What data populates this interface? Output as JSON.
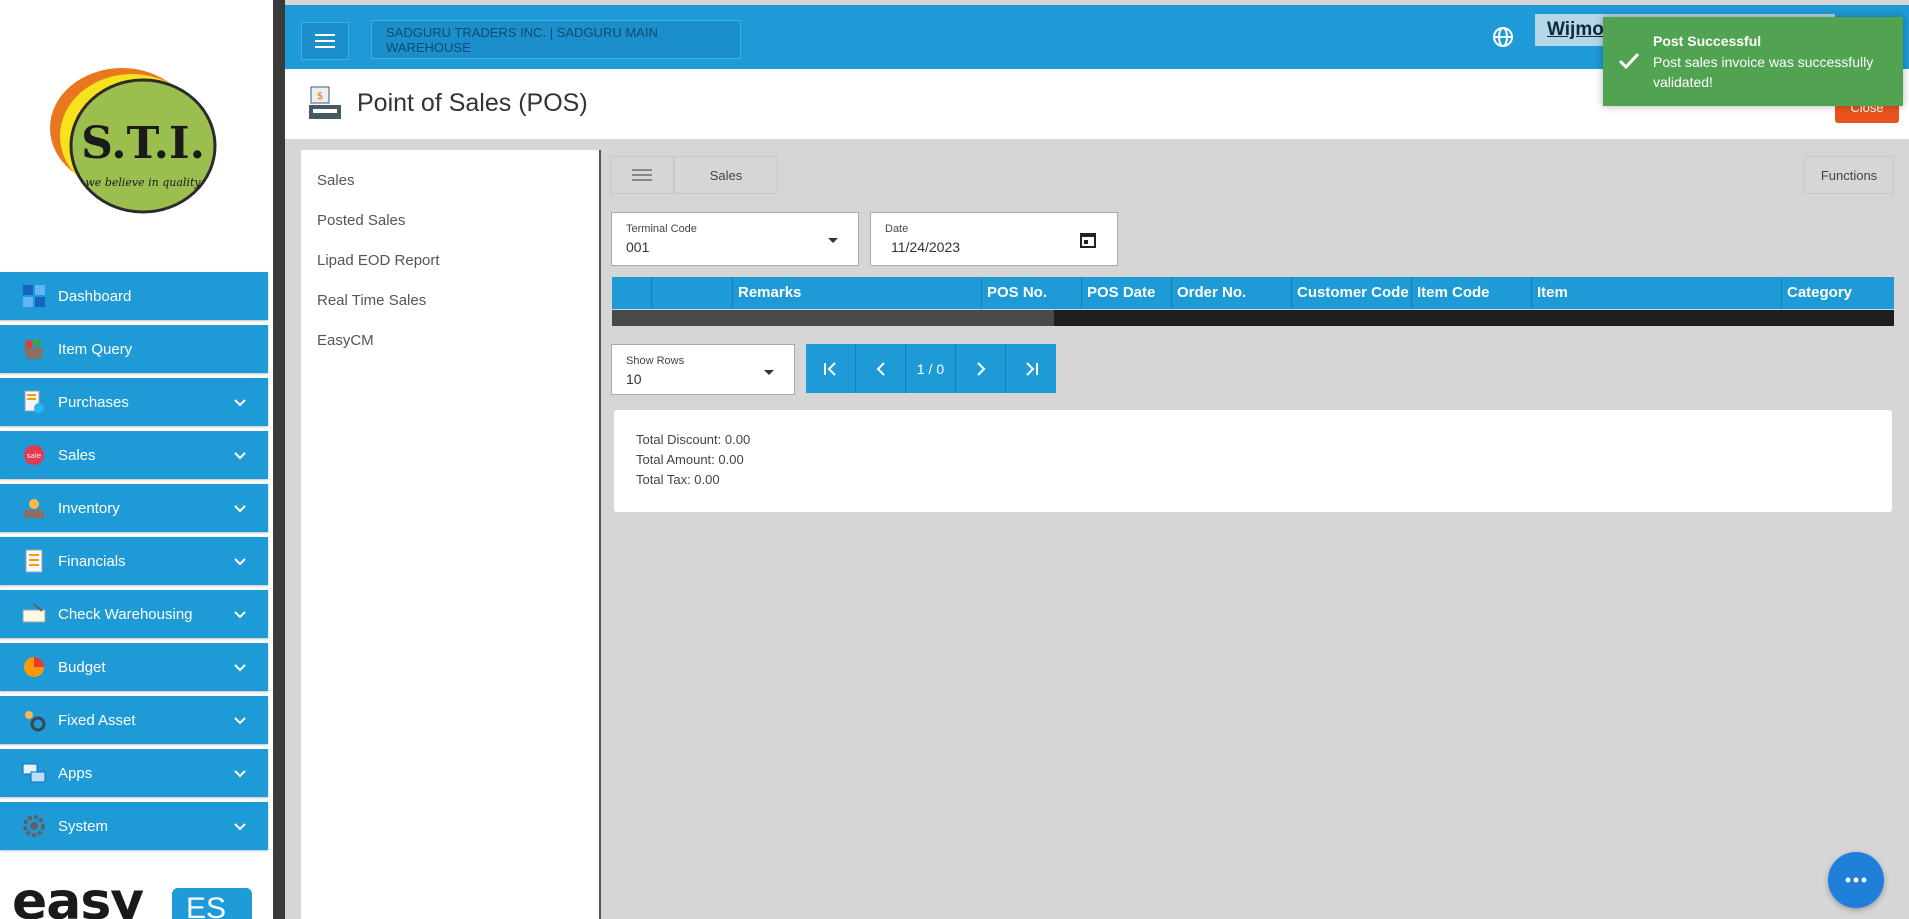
{
  "sidebar": {
    "items": [
      {
        "label": "Dashboard",
        "icon": "dashboard-icon"
      },
      {
        "label": "Item Query",
        "icon": "basket-icon"
      },
      {
        "label": "Purchases",
        "icon": "purchases-icon"
      },
      {
        "label": "Sales",
        "icon": "sale-tag-icon"
      },
      {
        "label": "Inventory",
        "icon": "inventory-icon"
      },
      {
        "label": "Financials",
        "icon": "ledger-icon"
      },
      {
        "label": "Check Warehousing",
        "icon": "check-icon"
      },
      {
        "label": "Budget",
        "icon": "pie-chart-icon"
      },
      {
        "label": "Fixed Asset",
        "icon": "asset-gear-icon"
      },
      {
        "label": "Apps",
        "icon": "apps-icon"
      },
      {
        "label": "System",
        "icon": "system-gear-icon"
      }
    ],
    "logo_text": "S.T.I.",
    "logo_tagline": "we believe in quality",
    "brand": {
      "easy": "easy",
      "es": "ES"
    }
  },
  "topbar": {
    "company": "SADGURU TRADERS INC. | SADGURU MAIN WAREHOUSE",
    "user_label": "Wijmo"
  },
  "page": {
    "title": "Point of Sales (POS)",
    "close_label": "Close"
  },
  "submenu": [
    "Sales",
    "Posted Sales",
    "Lipad EOD Report",
    "Real Time Sales",
    "EasyCM"
  ],
  "content": {
    "tab_label": "Sales",
    "functions_label": "Functions",
    "terminal": {
      "label": "Terminal Code",
      "value": "001"
    },
    "date": {
      "label": "Date",
      "value": "11/24/2023"
    },
    "columns": [
      "",
      "",
      "Remarks",
      "POS No.",
      "POS Date",
      "Order No.",
      "Customer Code",
      "Item Code",
      "Item",
      "Category"
    ],
    "show_rows": {
      "label": "Show Rows",
      "value": "10"
    },
    "pager_text": "1 / 0",
    "totals": {
      "discount": "Total Discount: 0.00",
      "amount": "Total Amount: 0.00",
      "tax": "Total Tax: 0.00"
    }
  },
  "toast": {
    "title": "Post Successful",
    "message": "Post sales invoice was successfully validated!"
  },
  "colors": {
    "primary": "#1e9bd7",
    "success": "#51a351",
    "close": "#e8531f"
  }
}
